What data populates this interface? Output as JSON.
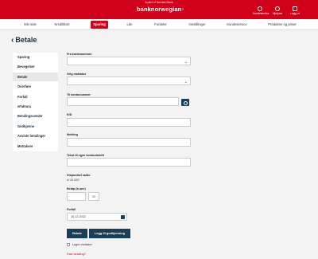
{
  "header": {
    "part_of": "A part of Nordea Bank",
    "logo": "banknorwegian",
    "buttons": [
      {
        "label": "Kundeservice",
        "icon": "user-icon"
      },
      {
        "label": "Hjelpcal",
        "icon": "help-icon"
      },
      {
        "label": "Logg ut",
        "icon": "logout-icon"
      }
    ]
  },
  "nav": {
    "items": [
      "Min side",
      "Kredittkort",
      "Sparing",
      "Lån",
      "Fordeler",
      "Innstillinger",
      "Kundeservice",
      "Produkter og priser"
    ],
    "active_index": 2
  },
  "page": {
    "title": "Betale"
  },
  "sidebar": {
    "items": [
      "Sparing",
      "Bevegelser",
      "Betale",
      "Overføre",
      "Forfall",
      "eFaktura",
      "Betalingsavtaler",
      "Godkjenne",
      "Avviste betalinger",
      "Mottakere"
    ],
    "active_index": 2
  },
  "form": {
    "from_account_label": "Fra kontonummer",
    "recipient_label": "Velg mottaker",
    "to_account_label": "Til kontonummer",
    "kid_label": "KID",
    "message_label": "Melding",
    "own_text_label": "Tekst til egen kontoutskrift",
    "available_label": "Disponibel saldo",
    "available_value": "kr 20 000",
    "amount_label": "Beløp (kr,øre)",
    "ore_value": "00",
    "due_label": "Forfall",
    "due_value": "15.12.2022",
    "pay_button": "Betale",
    "approve_button": "Legg til godkjenning",
    "save_recipient": "Lagre mottaker",
    "lost_link": "Fast betaling?"
  },
  "colors": {
    "brand": "#d0021b",
    "primary": "#1a3e58"
  }
}
